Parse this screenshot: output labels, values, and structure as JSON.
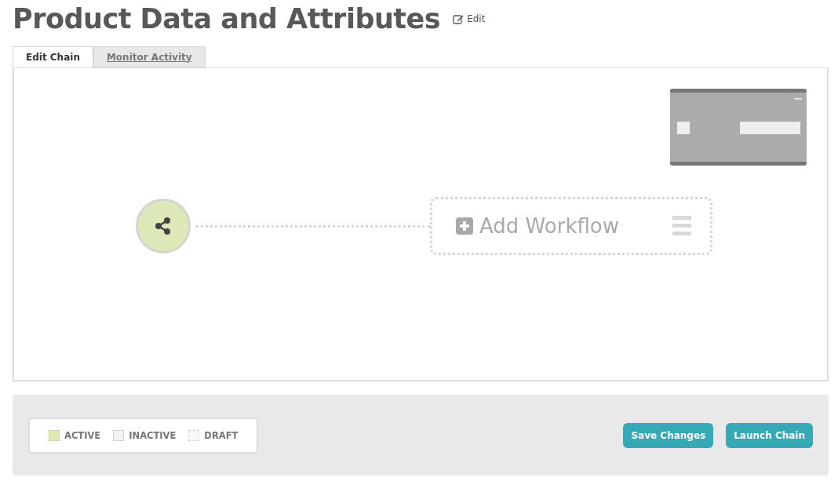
{
  "header": {
    "title": "Product Data and Attributes",
    "edit_link": "Edit"
  },
  "tabs": [
    {
      "label": "Edit Chain",
      "selected": true
    },
    {
      "label": "Monitor Activity",
      "selected": false
    }
  ],
  "canvas": {
    "add_node": {
      "label": "Add Workflow"
    }
  },
  "legend": [
    {
      "kind": "active",
      "label": "ACTIVE"
    },
    {
      "kind": "inactive",
      "label": "INACTIVE"
    },
    {
      "kind": "draft",
      "label": "DRAFT"
    }
  ],
  "buttons": [
    "Save Changes",
    "Launch Chain"
  ]
}
